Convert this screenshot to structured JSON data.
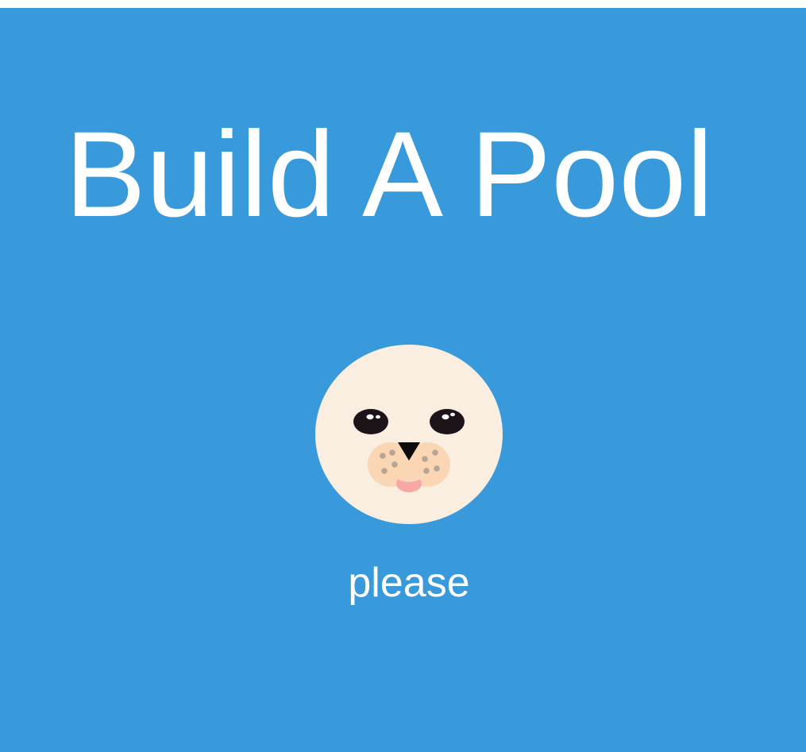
{
  "page": {
    "title": "Build A Pool",
    "caption": "please"
  },
  "colors": {
    "background": "#3899db",
    "text": "#ffffff",
    "seal_face": "#f9eedf",
    "seal_muzzle": "#fbd6b5",
    "seal_whisker_dots": "#b8a493",
    "seal_tongue": "#f7a8a5",
    "seal_eye": "#1c1419",
    "seal_nose": "#0b0b0b"
  },
  "icons": {
    "mascot": "seal-face-icon"
  }
}
